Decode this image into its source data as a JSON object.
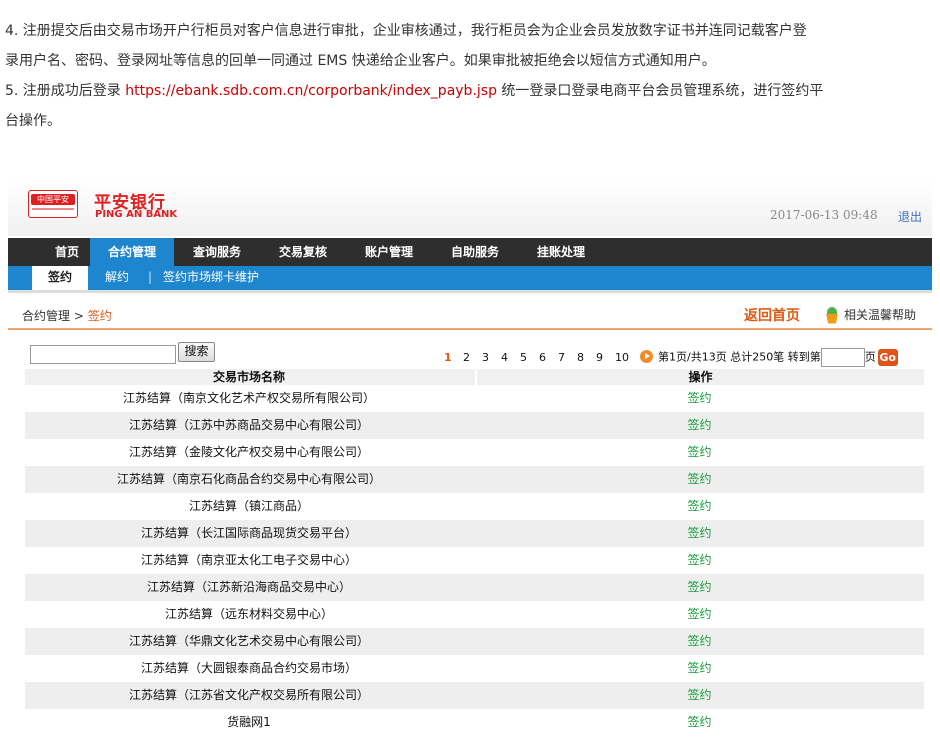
{
  "article": {
    "para4_line1": "4. 注册提交后由交易市场开户行柜员对客户信息进行审批，企业审核通过，我行柜员会为企业会员发放数字证书并连同记载客户登",
    "para4_line2": "录用户名、密码、登录网址等信息的回单一同通过 EMS 快递给企业客户。如果审批被拒绝会以短信方式通知用户。",
    "para5_prefix": "5. 注册成功后登录 ",
    "para5_link": "https://ebank.sdb.com.cn/corporbank/index_payb.jsp",
    "para5_suffix": " 统一登录口登录电商平台会员管理系统，进行签约平",
    "para5_line2": "台操作。"
  },
  "header": {
    "logo_badge": "中国平安",
    "logo_cn": "平安银行",
    "logo_en": "PING AN BANK",
    "datetime": "2017-06-13  09:48",
    "logout": "退出"
  },
  "main_nav": [
    "首页",
    "合约管理",
    "查询服务",
    "交易复核",
    "账户管理",
    "自助服务",
    "挂账处理"
  ],
  "main_nav_active": 1,
  "sub_nav": {
    "sign": "签约",
    "unsign": "解约",
    "sep": "|",
    "maintain": "签约市场绑卡维护"
  },
  "breadcrumb": {
    "root": "合约管理",
    "arrow": " > ",
    "current": "签约"
  },
  "actions": {
    "back_home": "返回首页",
    "help": "相关温馨帮助"
  },
  "search": {
    "button": "搜索",
    "value": ""
  },
  "pager": {
    "pages": [
      "1",
      "2",
      "3",
      "4",
      "5",
      "6",
      "7",
      "8",
      "9",
      "10"
    ],
    "current_page": "1",
    "info": "第1页/共13页 总计250笔 转到第",
    "page_suffix": "页",
    "go": "Go"
  },
  "table": {
    "headers": [
      "交易市场名称",
      "操作"
    ],
    "rows": [
      {
        "name": "江苏结算（南京文化艺术产权交易所有限公司）",
        "op": "签约"
      },
      {
        "name": "江苏结算（江苏中苏商品交易中心有限公司）",
        "op": "签约"
      },
      {
        "name": "江苏结算（金陵文化产权交易中心有限公司）",
        "op": "签约"
      },
      {
        "name": "江苏结算（南京石化商品合约交易中心有限公司）",
        "op": "签约"
      },
      {
        "name": "江苏结算（镇江商品）",
        "op": "签约"
      },
      {
        "name": "江苏结算（长江国际商品现货交易平台）",
        "op": "签约"
      },
      {
        "name": "江苏结算（南京亚太化工电子交易中心）",
        "op": "签约"
      },
      {
        "name": "江苏结算（江苏新沿海商品交易中心）",
        "op": "签约"
      },
      {
        "name": "江苏结算（远东材料交易中心）",
        "op": "签约"
      },
      {
        "name": "江苏结算（华鼎文化艺术交易中心有限公司）",
        "op": "签约"
      },
      {
        "name": "江苏结算（大圆银泰商品合约交易市场）",
        "op": "签约"
      },
      {
        "name": "江苏结算（江苏省文化产权交易所有限公司）",
        "op": "签约"
      },
      {
        "name": "货融网1",
        "op": "签约"
      }
    ]
  },
  "colors": {
    "brand_red": "#e02020",
    "nav_dark": "#2e2e2e",
    "nav_blue": "#1e86cf",
    "accent_orange": "#e05a14",
    "link_green": "#1a9b3c"
  }
}
